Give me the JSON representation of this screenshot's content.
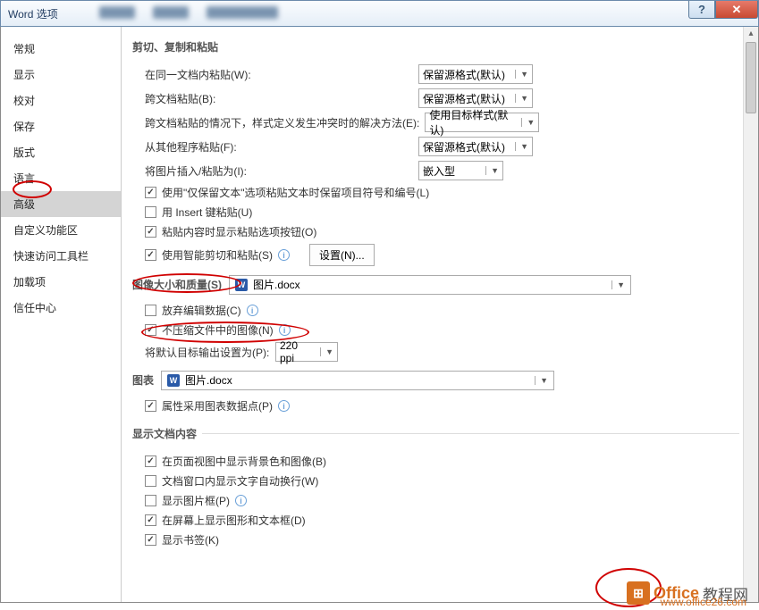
{
  "titlebar": {
    "title": "Word 选项"
  },
  "sidebar": {
    "items": [
      {
        "label": "常规"
      },
      {
        "label": "显示"
      },
      {
        "label": "校对"
      },
      {
        "label": "保存"
      },
      {
        "label": "版式"
      },
      {
        "label": "语言"
      },
      {
        "label": "高级",
        "selected": true
      },
      {
        "label": "自定义功能区"
      },
      {
        "label": "快速访问工具栏"
      },
      {
        "label": "加载项"
      },
      {
        "label": "信任中心"
      }
    ]
  },
  "sections": {
    "cut_copy_paste": {
      "title": "剪切、复制和粘贴",
      "within_doc": {
        "label": "在同一文档内粘贴(W):",
        "value": "保留源格式(默认)"
      },
      "cross_doc": {
        "label": "跨文档粘贴(B):",
        "value": "保留源格式(默认)"
      },
      "cross_conflict": {
        "label": "跨文档粘贴的情况下，样式定义发生冲突时的解决方法(E):",
        "value": "使用目标样式(默认)"
      },
      "from_other": {
        "label": "从其他程序粘贴(F):",
        "value": "保留源格式(默认)"
      },
      "insert_pic": {
        "label": "将图片插入/粘贴为(I):",
        "value": "嵌入型"
      },
      "keep_bullets": {
        "label": "使用\"仅保留文本\"选项粘贴文本时保留项目符号和编号(L)",
        "checked": true
      },
      "insert_key": {
        "label": "用 Insert 键粘贴(U)",
        "checked": false
      },
      "show_paste_btn": {
        "label": "粘贴内容时显示粘贴选项按钮(O)",
        "checked": true
      },
      "smart_cut": {
        "label": "使用智能剪切和粘贴(S)",
        "checked": true
      },
      "settings_btn": "设置(N)..."
    },
    "image_quality": {
      "title": "图像大小和质量(S)",
      "doc": "图片.docx",
      "discard_edit": {
        "label": "放弃编辑数据(C)",
        "checked": false
      },
      "no_compress": {
        "label": "不压缩文件中的图像(N)",
        "checked": true
      },
      "default_res": {
        "label": "将默认目标输出设置为(P):",
        "value": "220 ppi"
      }
    },
    "chart": {
      "title": "图表",
      "doc": "图片.docx",
      "prop_datapoint": {
        "label": "属性采用图表数据点(P)",
        "checked": true
      }
    },
    "display_content": {
      "title": "显示文档内容",
      "bg_in_page": {
        "label": "在页面视图中显示背景色和图像(B)",
        "checked": true
      },
      "wrap_text": {
        "label": "文档窗口内显示文字自动换行(W)",
        "checked": false
      },
      "pic_frame": {
        "label": "显示图片框(P)",
        "checked": false
      },
      "draw_text": {
        "label": "在屏幕上显示图形和文本框(D)",
        "checked": true
      },
      "bookmarks": {
        "label": "显示书签(K)",
        "checked": true
      }
    }
  },
  "watermark": {
    "text1": "Office",
    "text2": "教程网",
    "url": "www.office26.com"
  }
}
